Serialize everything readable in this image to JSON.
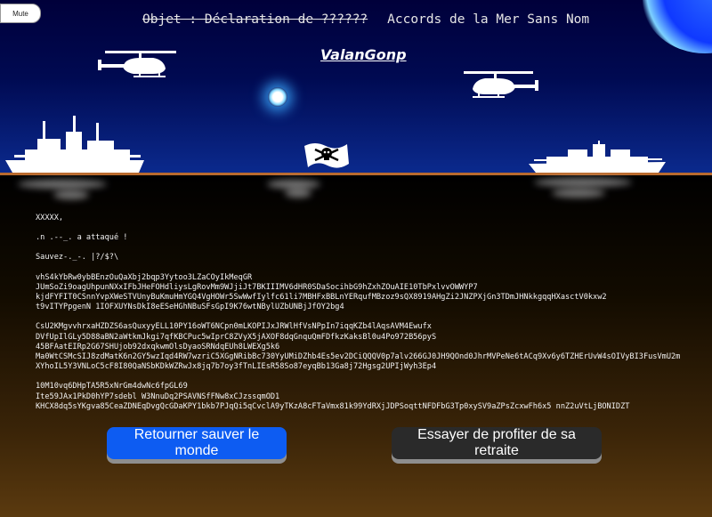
{
  "controls": {
    "mute_label": "Mute"
  },
  "header": {
    "subject": "Objet : Déclaration de ??????",
    "title": "Accords de la Mer Sans Nom",
    "signature": "ValanGonp"
  },
  "letter": {
    "greeting": "XXXXX,",
    "line1": ".n .--_. a attaqué !",
    "line2": "Sauvez-._-. |?/$?\\",
    "block1": [
      "vhS4kYbRw0ybBEnzOuQaXbj2bqp3Yytoo3LZaCOyIkMeqGR",
      "JUmSoZi9oagUhpunNXxIFbJHeFOHdliysLgRovMm9WJjiJt7BKIIIMV6dHR0SDaSocihbG9hZxhZOuAIE10TbPxlvvOWWYP7",
      "kjdFYFIT0CSnnYvpXWeSTVUnyBuKmuHmYGQ4VgHOWr5SwWwfIylfc61li7MBHFxBBLnYERqufMBzoz9sQX8919AHgZi2JNZPXjGn3TDmJHNkkgqqHXasctV0kxw2",
      "t9vITYPpgenN 1IOFXUYNsDkI8eESeHGhNBuSFsGpI9K76wtNBylUZbUNBjJfOY2bg4"
    ],
    "block2": [
      "CsU2KMgvvhrxaHZDZS6asQuxyyELL10PY16oWT6NCpn0mLKOPIJxJRWlHfVsNPpIn7iqqKZb4lAqsAVM4Ewufx",
      "DVfUpIlGLy5D88aBN2aWtkmJkgi7qfKBCPuc5wIprC8ZVyX5jAXOF8dqGnquQmFDfkzKaksBl0u4Po972B56pyS",
      "45BFAatEIRp2G67SHUjob92dxqkwmOlsDyaoSRNdqEUh8LWEXg5k6",
      "Ma0WtCSMcSIJ8zdMatK6n2GY5wzIqd4RW7wzriC5XGgNRibBc730YyUMiDZhb4Es5ev2DCiQQQV0p7alv266GJ0JH9QOnd0JhrMVPeNe6tACq9Xv6y6TZHErUvW4sOIVyBI3FusVmU2m",
      "XYhoIL5Y3VNLoC5cF8I80QaNSbKDkWZRwJx8jq7b7oy3fTnLIEsR58So87eyqBb13Ga8j72Hgsg2UPIjWyh3Ep4"
    ],
    "block3": [
      "10M10vq6DHpTA5R5xNrGm4dwNc6fpGL69",
      "Ite59JAx1PkD0hYP7sdebl W3NnuDq2PSAVNSfFNw8xCJzssqmOD1",
      "KHCX8dq5sYKgva85CeaZDNEqDvgQcGDaKPY1bkb7PJqQi5qCvclA9yTKzA8cFTaVmx81k99YdRXjJDPSoqttNFDFbG3Tp0xySV9aZPsZcxwFh6x5 nnZ2uVtLjBONIDZT"
    ]
  },
  "actions": {
    "save_label": "Retourner sauver le monde",
    "retire_label": "Essayer de profiter de sa retraite"
  },
  "colors": {
    "sky_top": "#00003a",
    "sky_bottom": "#0b2a8e",
    "horizon": "#b96a2e",
    "save_button": "#0d5cf2",
    "retire_button": "#2a2a2a"
  }
}
